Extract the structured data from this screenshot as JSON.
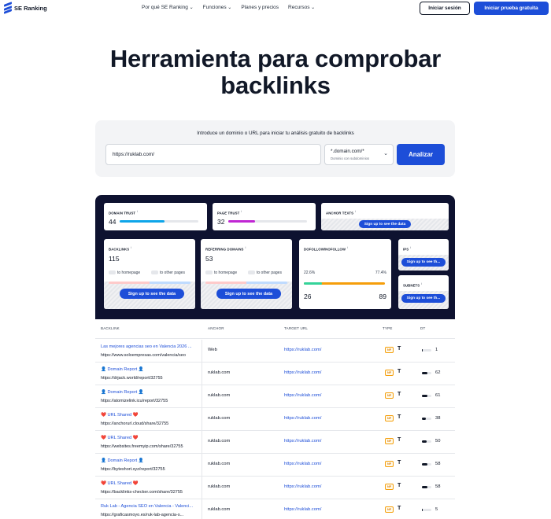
{
  "nav": {
    "brand": "SE Ranking",
    "menu": [
      "Por qué SE Ranking",
      "Funciones",
      "Planes y precios",
      "Recursos"
    ],
    "login": "Iniciar sesión",
    "trial": "Iniciar prueba gratuita"
  },
  "hero": {
    "line1": "Herramienta para comprobar",
    "line2": "backlinks"
  },
  "form": {
    "label": "Introduce un dominio o URL para iniciar tu análisis gratuito de backlinks",
    "url_value": "https://ruklab.com/",
    "scope_value": "*.domain.com/*",
    "scope_hint": "Dominio con subdominios",
    "submit": "Analizar"
  },
  "dashboard": {
    "domain_trust": {
      "label": "DOMAIN TRUST",
      "value": "44",
      "level": 0.44
    },
    "page_trust": {
      "label": "PAGE TRUST",
      "value": "32",
      "level": 0.32
    },
    "anchor_texts": {
      "label": "ANCHOR TEXTS"
    },
    "backlinks": {
      "label": "BACKLINKS",
      "value": "115",
      "to_home": "to homepage",
      "to_other": "to other pages"
    },
    "referring_domains": {
      "label": "REFERRING DOMAINS",
      "value": "53",
      "to_home": "to homepage",
      "to_other": "to other pages"
    },
    "dofollow": {
      "label": "DOFOLLOW/NOFOLLOW",
      "pct_do": "22.6%",
      "pct_no": "77.4%",
      "do_share": 0.226,
      "count_do": "26",
      "count_no": "89"
    },
    "ips": {
      "label": "IPS"
    },
    "subnets": {
      "label": "SUBNETS"
    },
    "signup": "Sign up to see the data",
    "signup_short": "Sign up to see th..."
  },
  "table": {
    "headers": {
      "backlink": "BACKLINK",
      "anchor": "ANCHOR",
      "target": "TARGET URL",
      "type": "TYPE",
      "dt": "DT"
    },
    "rows": [
      {
        "title": "Las mejores agencias seo en Valencia 2026 ...",
        "url": "https://www.soloempresas.com/valencia/seo",
        "anchor": "Web",
        "target": "https://ruklab.com/",
        "type": "NF",
        "dt": "1",
        "dt_level": 0.05
      },
      {
        "title": "👤 Domain Report 👤",
        "url": "https://drjack.world/report/32755",
        "anchor": "ruklab.com",
        "target": "https://ruklab.com/",
        "type": "NF",
        "dt": "62",
        "dt_level": 0.62
      },
      {
        "title": "👤 Domain Report 👤",
        "url": "https://atomizelink.icu/report/32755",
        "anchor": "ruklab.com",
        "target": "https://ruklab.com/",
        "type": "NF",
        "dt": "61",
        "dt_level": 0.61
      },
      {
        "title": "❤️ URL Shared ❤️",
        "url": "https://anchorurl.cloud/share/32755",
        "anchor": "ruklab.com",
        "target": "https://ruklab.com/",
        "type": "NF",
        "dt": "38",
        "dt_level": 0.38
      },
      {
        "title": "❤️ URL Shared ❤️",
        "url": "https://websites.freemyip.com/share/32755",
        "anchor": "ruklab.com",
        "target": "https://ruklab.com/",
        "type": "NF",
        "dt": "50",
        "dt_level": 0.5
      },
      {
        "title": "👤 Domain Report 👤",
        "url": "https://byteshort.xyz/report/32755",
        "anchor": "ruklab.com",
        "target": "https://ruklab.com/",
        "type": "NF",
        "dt": "58",
        "dt_level": 0.58
      },
      {
        "title": "❤️ URL Shared ❤️",
        "url": "https://backlinks-checker.com/share/32755",
        "anchor": "ruklab.com",
        "target": "https://ruklab.com/",
        "type": "NF",
        "dt": "58",
        "dt_level": 0.58
      },
      {
        "title": "Ruk Lab - Agencia SEO en Valencia - Valenci...",
        "url": "https://graficasmoyo.es/ruk-lab-agencia-s...",
        "anchor": "ruklab.com",
        "target": "https://ruklab.com/",
        "type": "NF",
        "dt": "5",
        "dt_level": 0.08
      }
    ]
  }
}
